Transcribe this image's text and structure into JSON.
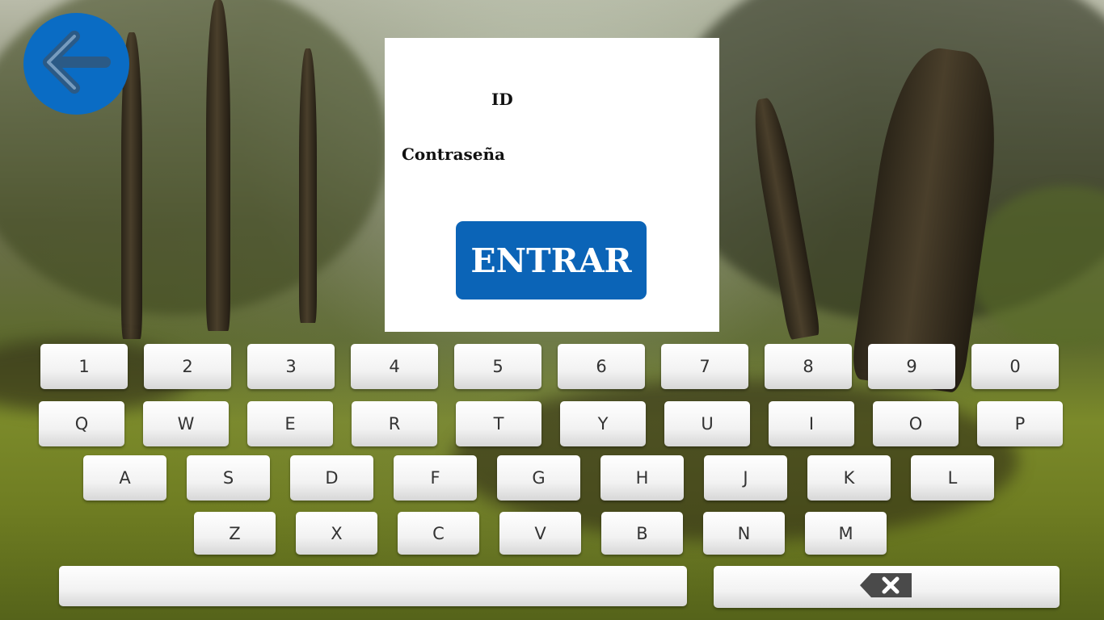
{
  "login": {
    "id_label": "ID",
    "password_label": "Contraseña",
    "enter_label": "ENTRAR"
  },
  "keyboard": {
    "row1": [
      "1",
      "2",
      "3",
      "4",
      "5",
      "6",
      "7",
      "8",
      "9",
      "0"
    ],
    "row2": [
      "Q",
      "W",
      "E",
      "R",
      "T",
      "Y",
      "U",
      "I",
      "O",
      "P"
    ],
    "row3": [
      "A",
      "S",
      "D",
      "F",
      "G",
      "H",
      "J",
      "K",
      "L"
    ],
    "row4": [
      "Z",
      "X",
      "C",
      "V",
      "B",
      "N",
      "M"
    ]
  },
  "icons": {
    "back": "arrow-left-icon",
    "backspace": "backspace-icon"
  },
  "colors": {
    "accent": "#0b64b7",
    "key": "#f2f2f2"
  }
}
